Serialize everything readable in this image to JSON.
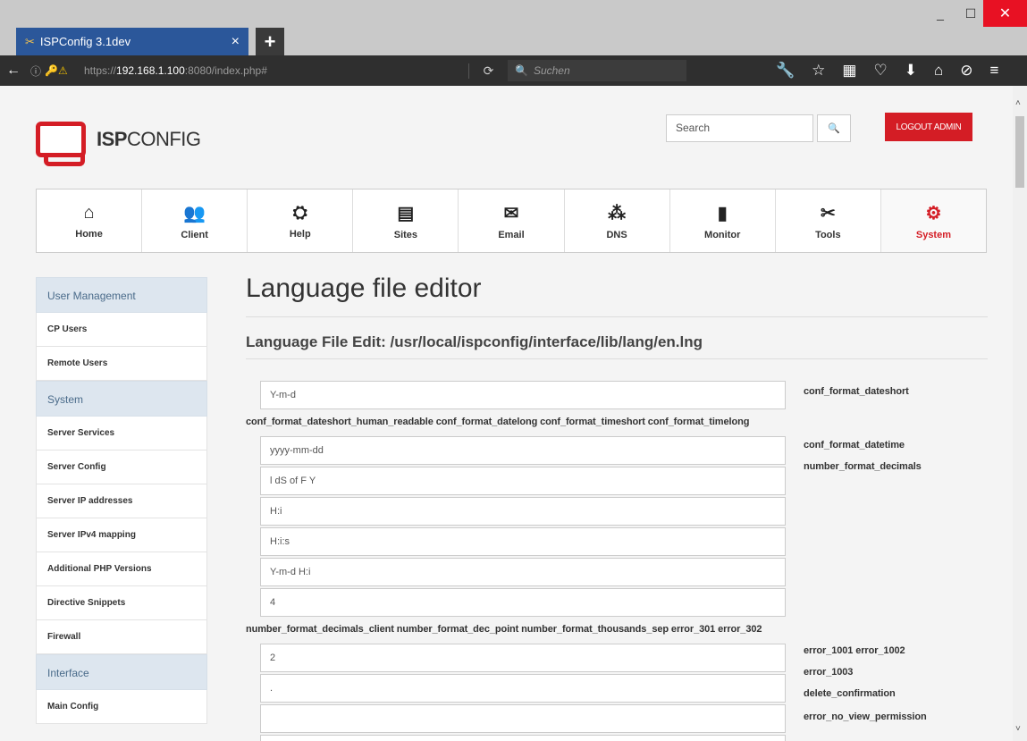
{
  "browser": {
    "tab_title": "ISPConfig 3.1dev",
    "tab_close": "×",
    "new_tab": "+",
    "url_prefix": "https://",
    "url_host": "192.168.1.100",
    "url_rest": ":8080/index.php#",
    "search_placeholder": "Suchen",
    "window_minimize": "_",
    "window_maximize": "☐",
    "window_close": "✕"
  },
  "header": {
    "logo_bold": "ISP",
    "logo_light": "CONFIG",
    "search_placeholder": "Search",
    "search_button": "🔍",
    "logout_label": "LOGOUT ADMIN"
  },
  "main_nav": [
    {
      "label": "Home",
      "icon": "home-icon",
      "glyph": "⌂"
    },
    {
      "label": "Client",
      "icon": "client-icon",
      "glyph": "👥"
    },
    {
      "label": "Help",
      "icon": "help-icon",
      "glyph": "⛭"
    },
    {
      "label": "Sites",
      "icon": "sites-icon",
      "glyph": "▤"
    },
    {
      "label": "Email",
      "icon": "email-icon",
      "glyph": "✉"
    },
    {
      "label": "DNS",
      "icon": "dns-icon",
      "glyph": "⁂"
    },
    {
      "label": "Monitor",
      "icon": "monitor-icon",
      "glyph": "▮"
    },
    {
      "label": "Tools",
      "icon": "tools-icon",
      "glyph": "✂"
    },
    {
      "label": "System",
      "icon": "system-icon",
      "glyph": "⚙",
      "active": true
    }
  ],
  "sidebar": {
    "sections": [
      {
        "title": "User Management",
        "items": [
          "CP Users",
          "Remote Users"
        ]
      },
      {
        "title": "System",
        "items": [
          "Server Services",
          "Server Config",
          "Server IP addresses",
          "Server IPv4 mapping",
          "Additional PHP Versions",
          "Directive Snippets",
          "Firewall"
        ]
      },
      {
        "title": "Interface",
        "items": [
          "Main Config"
        ]
      }
    ]
  },
  "main": {
    "title": "Language file editor",
    "subtitle": "Language File Edit: /usr/local/ispconfig/interface/lib/lang/en.lng"
  },
  "form": {
    "fields": [
      "Y-m-d",
      "yyyy-mm-dd",
      "l dS of F Y",
      "H:i",
      "H:i:s",
      "Y-m-d H:i",
      "4",
      "2",
      ".",
      "",
      ""
    ],
    "labels": {
      "l1": "conf_format_dateshort",
      "l2": "conf_format_dateshort_human_readable conf_format_datelong conf_format_timeshort conf_format_timelong",
      "l3": "conf_format_datetime",
      "l4": "number_format_decimals",
      "l5": "number_format_decimals_client number_format_dec_point number_format_thousands_sep error_301 error_302",
      "l6": "error_1001 error_1002",
      "l7": "error_1003",
      "l8": "delete_confirmation",
      "l9": "error_no_view_permission"
    }
  }
}
